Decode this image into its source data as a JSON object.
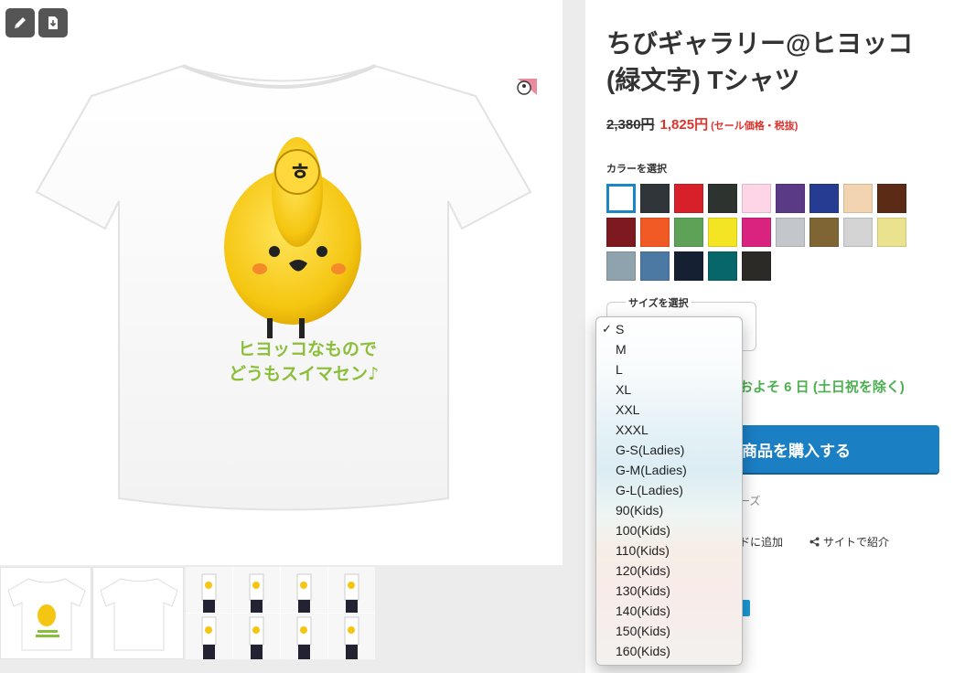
{
  "product": {
    "title": "ちびギャラリー@ヒヨッコ(緑文字) Tシャツ",
    "old_price": "2,380円",
    "sale_price": "1,825円",
    "sale_note": "(セール価格・税抜)"
  },
  "toolbar": {
    "edit_icon": "pencil-icon",
    "download_icon": "download-icon"
  },
  "artwork": {
    "text_line1": "ヒヨッコなもので",
    "text_line2": "どうもスイマセン♪"
  },
  "colors": {
    "label": "カラーを選択",
    "selected_index": 0,
    "swatches": [
      "#ffffff",
      "#2f3538",
      "#d7202a",
      "#2d332f",
      "#fdd5e6",
      "#5a3a87",
      "#253c92",
      "#f2d4b0",
      "#5b2b16",
      "#7e1a1f",
      "#f15a24",
      "#5ea258",
      "#f3e523",
      "#d9237f",
      "#c3c7cc",
      "#7f6533",
      "#d4d4d4",
      "#ebe28f",
      "#8fa3af",
      "#4c78a4",
      "#162033",
      "#06666a",
      "#2b2a27"
    ]
  },
  "size": {
    "legend": "サイズを選択",
    "selected": "S",
    "checkmark": "✓",
    "options": [
      "S",
      "M",
      "L",
      "XL",
      "XXL",
      "XXXL",
      "G-S(Ladies)",
      "G-M(Ladies)",
      "G-L(Ladies)",
      "90(Kids)",
      "100(Kids)",
      "110(Kids)",
      "120(Kids)",
      "130(Kids)",
      "140(Kids)",
      "150(Kids)",
      "160(Kids)"
    ]
  },
  "delivery": {
    "text": "およそ 6 日 (土日祝を除く)"
  },
  "buy": {
    "label": "商品を購入する"
  },
  "links": {
    "series": "ーズ",
    "add_guide": "ドに追加",
    "share": "サイトで紹介"
  }
}
